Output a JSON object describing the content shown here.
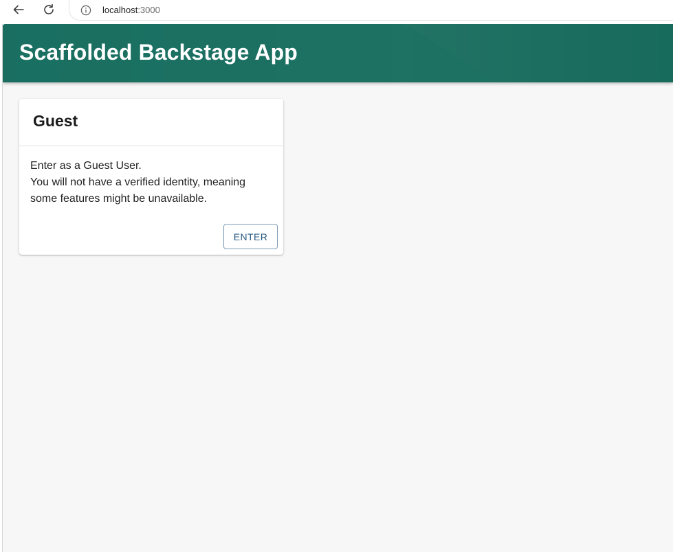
{
  "browser": {
    "url_host": "localhost",
    "url_port": ":3000",
    "back_icon": "arrow-left-icon",
    "reload_icon": "reload-icon",
    "info_icon": "info-icon"
  },
  "header": {
    "title": "Scaffolded Backstage App",
    "color": "#1e6b5e"
  },
  "guest_card": {
    "title": "Guest",
    "line1": "Enter as a Guest User.",
    "line2": "You will not have a verified identity, meaning",
    "line3": "some features might be unavailable.",
    "button_label": "ENTER",
    "button_color": "#2a5b84"
  }
}
